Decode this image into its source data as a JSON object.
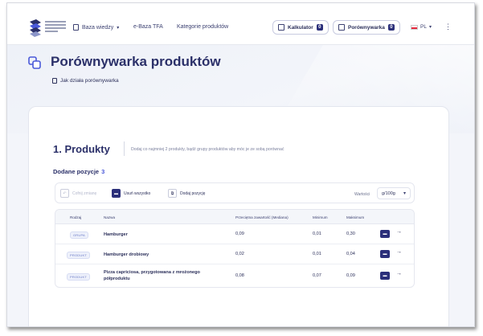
{
  "nav": {
    "items": [
      {
        "label": "Baza wiedzy",
        "icon": "book-icon",
        "dropdown": true
      },
      {
        "label": "e-Baza TFA"
      },
      {
        "label": "Kategorie produktów"
      }
    ],
    "calculator": {
      "label": "Kalkulator",
      "count": "0",
      "icon": "calculator-icon"
    },
    "compare": {
      "label": "Porównywarka",
      "count": "0",
      "icon": "compare-icon"
    },
    "language": "PL"
  },
  "page": {
    "title": "Porównywarka produktów",
    "howto_link": "Jak działa porównywarka"
  },
  "section": {
    "title": "1. Produkty",
    "description": "Dodaj co najmniej 2 produkty, bądź grupy produktów aby móc je ze sobą porównać",
    "added_label": "Dodane pozycje",
    "added_count": "3"
  },
  "toolbar": {
    "undo": "Cofnij zmianę",
    "remove_all": "Usuń wszystko",
    "add_item": "Dodaj pozycję",
    "units_label": "Wartości",
    "units_value": "g/100g"
  },
  "table": {
    "headers": [
      "Rodzaj",
      "Nazwa",
      "Przeciętna zawartość (Mediana)",
      "Minimum",
      "Maksimum"
    ],
    "rows": [
      {
        "type": "GRUPA",
        "name": "Hamburger",
        "median": "0,09",
        "min": "0,01",
        "max": "0,30"
      },
      {
        "type": "PRODUKT",
        "name": "Hamburger drobiowy",
        "median": "0,02",
        "min": "0,01",
        "max": "0,04"
      },
      {
        "type": "PRODUKT",
        "name": "Pizza capriciosa, przygotowana z mrożonego półproduktu",
        "median": "0,08",
        "min": "0,07",
        "max": "0,09"
      }
    ]
  },
  "colors": {
    "primary": "#2b2f7a",
    "accent": "#4a59d9",
    "flag_red": "#e8283c"
  }
}
